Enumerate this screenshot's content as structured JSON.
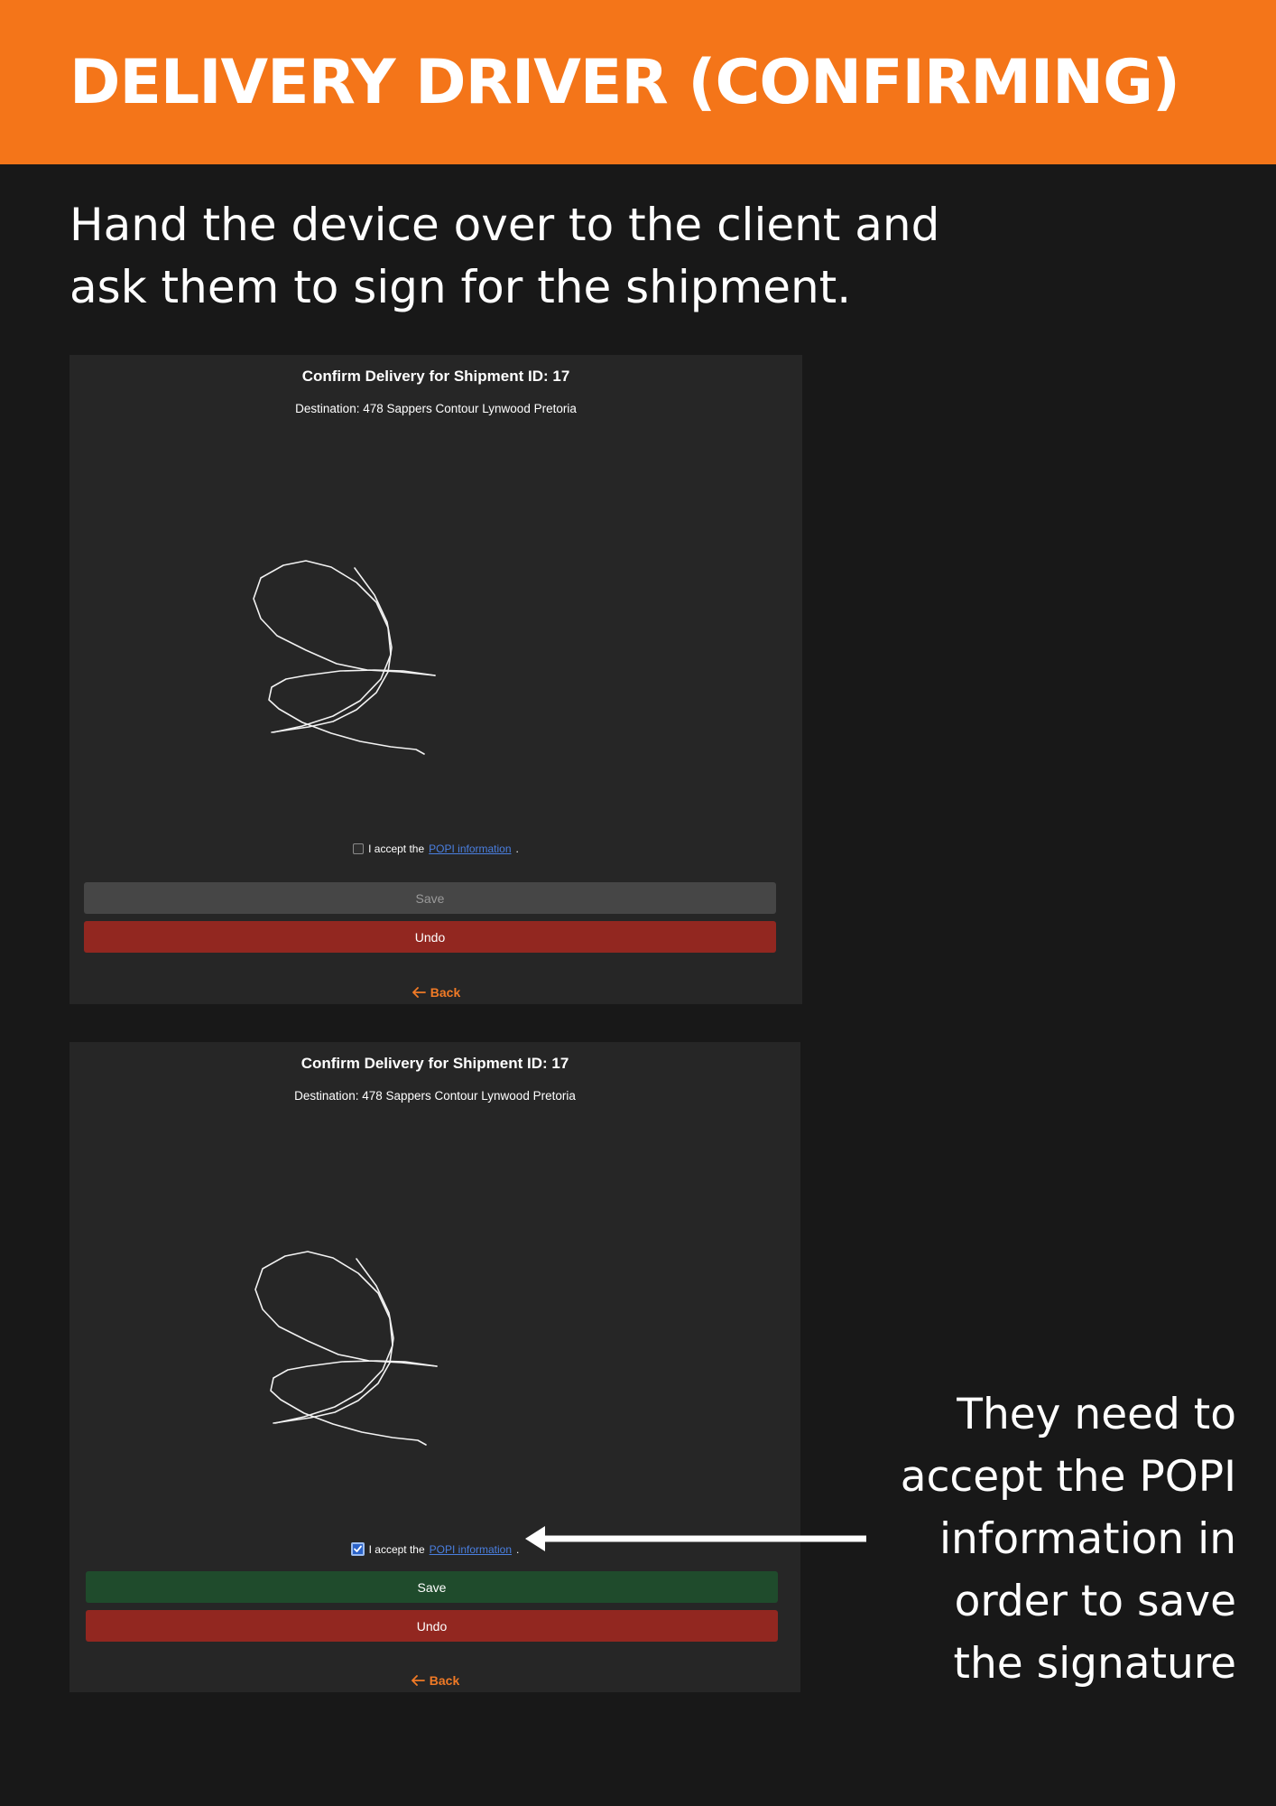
{
  "header": {
    "title": "DELIVERY DRIVER (CONFIRMING)",
    "background_color": "#f47519"
  },
  "intro": {
    "line1": "Hand the device over to the client and",
    "line2": "ask them to sign for the shipment."
  },
  "screen_before": {
    "title": "Confirm Delivery for Shipment ID: 17",
    "destination": "Destination: 478 Sappers Contour Lynwood Pretoria",
    "accept_prefix": "I accept the",
    "popi_link": "POPI information",
    "accept_suffix": ".",
    "checkbox_checked": false,
    "save_label": "Save",
    "save_state": "disabled",
    "undo_label": "Undo",
    "back_label": "Back",
    "back_icon": "arrow-left-icon"
  },
  "screen_after": {
    "title": "Confirm Delivery for Shipment ID: 17",
    "destination": "Destination: 478 Sappers Contour Lynwood Pretoria",
    "accept_prefix": "I accept the",
    "popi_link": "POPI information",
    "accept_suffix": ".",
    "checkbox_checked": true,
    "save_label": "Save",
    "save_state": "enabled",
    "undo_label": "Undo",
    "back_label": "Back",
    "back_icon": "arrow-left-icon"
  },
  "callout": {
    "line1": "They need to",
    "line2": "accept the POPI",
    "line3": "information in",
    "line4": "order to save",
    "line5": "the signature"
  },
  "colors": {
    "accent": "#f47519",
    "save_enabled": "#1f4b2c",
    "save_disabled": "#464646",
    "undo": "#922720",
    "link": "#4a7fe0",
    "back": "#f07a26"
  }
}
